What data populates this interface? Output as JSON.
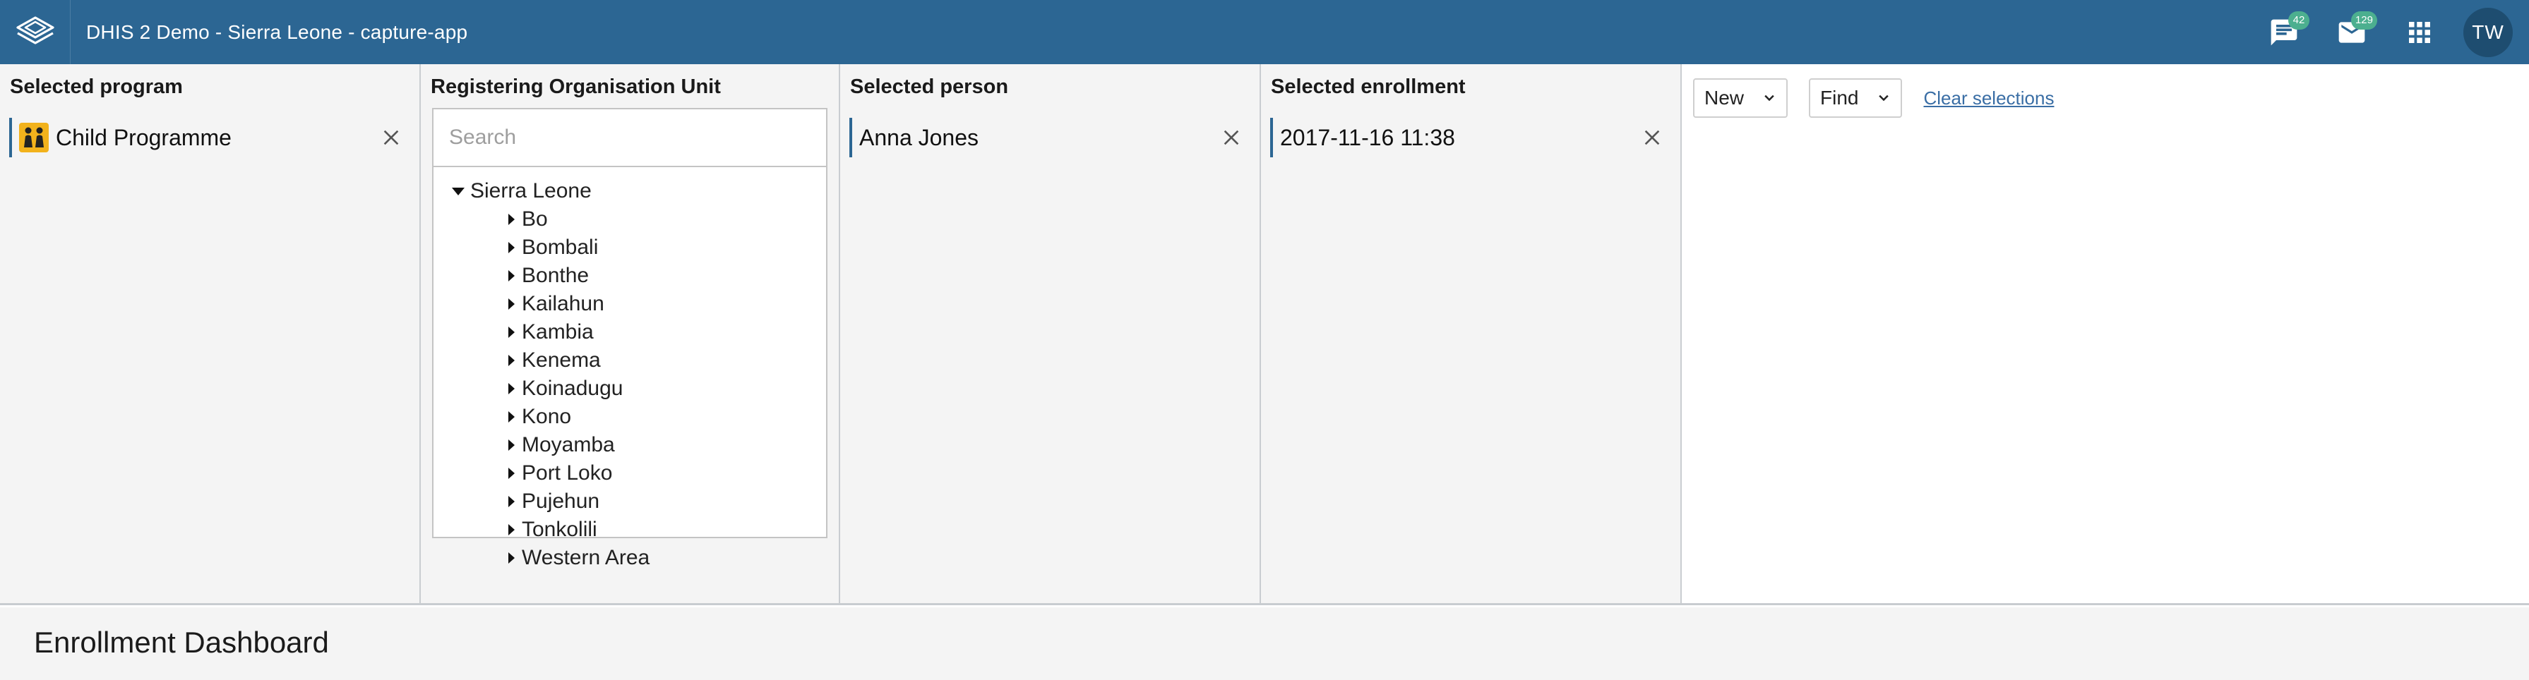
{
  "header": {
    "title": "DHIS 2 Demo - Sierra Leone - capture-app",
    "messages_badge": "42",
    "mail_badge": "129",
    "avatar_initials": "TW"
  },
  "program_panel": {
    "title": "Selected program",
    "value": "Child Programme",
    "icon": "child-programme-icon"
  },
  "orgunit_panel": {
    "title": "Registering Organisation Unit",
    "search_placeholder": "Search",
    "root": "Sierra Leone",
    "children": [
      "Bo",
      "Bombali",
      "Bonthe",
      "Kailahun",
      "Kambia",
      "Kenema",
      "Koinadugu",
      "Kono",
      "Moyamba",
      "Port Loko",
      "Pujehun",
      "Tonkolili",
      "Western Area"
    ]
  },
  "person_panel": {
    "title": "Selected person",
    "value": "Anna Jones"
  },
  "enrollment_panel": {
    "title": "Selected enrollment",
    "value": "2017-11-16 11:38"
  },
  "actions": {
    "new_label": "New",
    "find_label": "Find",
    "clear_label": "Clear selections"
  },
  "dashboard": {
    "title": "Enrollment Dashboard"
  },
  "colors": {
    "header_bg": "#2c6693",
    "accent": "#2c6693",
    "badge": "#4caf8f"
  }
}
